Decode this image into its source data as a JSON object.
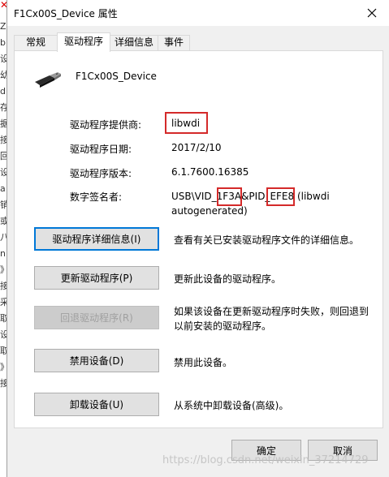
{
  "background": {
    "close_mark": "✕",
    "side_chars": [
      "Z",
      "b",
      "设",
      "幼",
      "d",
      "存",
      "据",
      "接",
      "回",
      "设",
      "a",
      "销",
      "或",
      "八",
      "n",
      "》",
      "接",
      "采",
      "取",
      "设",
      "取",
      "》",
      "接"
    ]
  },
  "dialog": {
    "title": "F1Cx00S_Device 属性",
    "close_icon": "close-icon"
  },
  "tabs": [
    "常规",
    "驱动程序",
    "详细信息",
    "事件"
  ],
  "device": {
    "icon": "usb-plug-icon",
    "name": "F1Cx00S_Device"
  },
  "info": {
    "provider_label": "驱动程序提供商:",
    "provider_value": "libwdi",
    "date_label": "驱动程序日期:",
    "date_value": "2017/2/10",
    "version_label": "驱动程序版本:",
    "version_value": "6.1.7600.16385",
    "signer_label": "数字签名者:",
    "signer_line1_a": "USB\\VID_",
    "signer_vid": "1F3A",
    "signer_line1_b": "&PID_",
    "signer_pid": "EFE8",
    "signer_line1_c": " (libwdi",
    "signer_line2": "autogenerated)"
  },
  "actions": [
    {
      "label": "驱动程序详细信息(I)",
      "desc1": "查看有关已安装驱动程序文件的详细信息。",
      "desc2": "",
      "state": "focused"
    },
    {
      "label": "更新驱动程序(P)",
      "desc1": "更新此设备的驱动程序。",
      "desc2": "",
      "state": "normal"
    },
    {
      "label": "回退驱动程序(R)",
      "desc1": "如果该设备在更新驱动程序时失败，则回退到",
      "desc2": "以前安装的驱动程序。",
      "state": "disabled"
    },
    {
      "label": "禁用设备(D)",
      "desc1": "禁用此设备。",
      "desc2": "",
      "state": "normal"
    },
    {
      "label": "卸载设备(U)",
      "desc1": "从系统中卸载设备(高级)。",
      "desc2": "",
      "state": "normal"
    }
  ],
  "footer": {
    "ok_label": "确定",
    "cancel_label": "取消"
  },
  "watermark": "https://blog.csdn.net/weixin_37214729",
  "colors": {
    "highlight_box": "#d42a2a",
    "focus_border": "#0078d7",
    "dialog_bg": "#f0f0f0"
  }
}
